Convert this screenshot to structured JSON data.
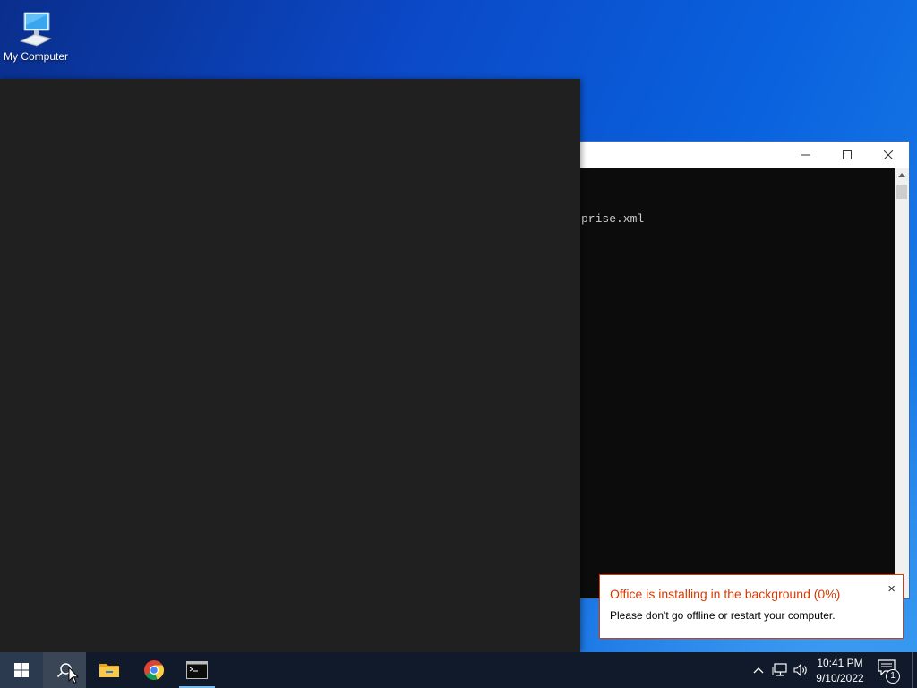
{
  "desktop": {
    "icons": [
      {
        "label": "My Computer",
        "icon": "computer-icon"
      }
    ]
  },
  "console_window": {
    "controls": {
      "minimize": "—",
      "maximize": "☐",
      "close": "✕"
    },
    "visible_text": "prise.xml"
  },
  "notification": {
    "title": "Office is installing in the background (0%)",
    "message": "Please don't go offline or restart your computer.",
    "close": "×",
    "accent_color": "#d83b01",
    "progress_percent": 0
  },
  "taskbar": {
    "apps": [
      {
        "name": "Start",
        "icon": "windows-logo-icon"
      },
      {
        "name": "Search",
        "icon": "search-icon"
      },
      {
        "name": "File Explorer",
        "icon": "folder-icon"
      },
      {
        "name": "Google Chrome",
        "icon": "chrome-icon"
      },
      {
        "name": "Command Prompt",
        "icon": "cmd-icon",
        "active": true
      }
    ],
    "tray": {
      "icons": [
        "chevron-up-icon",
        "network-icon",
        "volume-icon"
      ],
      "time": "10:41 PM",
      "date": "9/10/2022",
      "notifications_count": "1"
    }
  }
}
